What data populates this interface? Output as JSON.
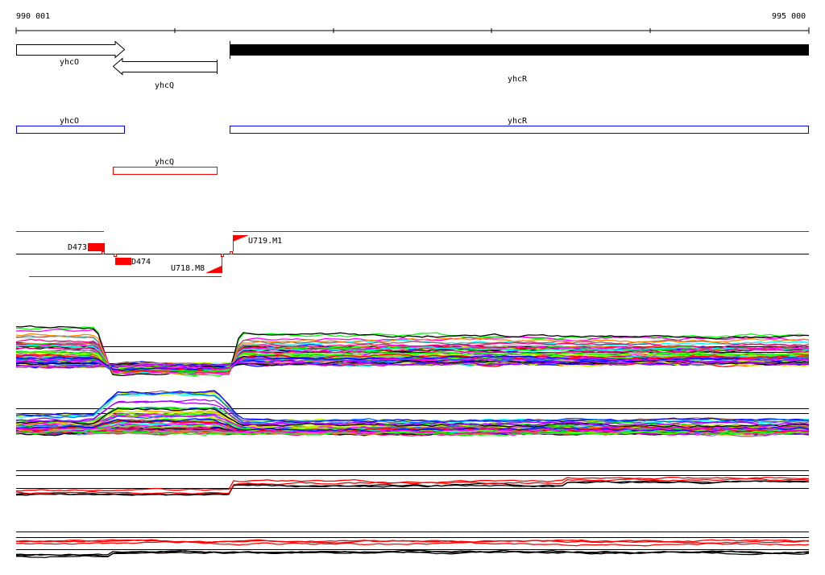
{
  "ruler": {
    "start_label": "990 001",
    "end_label": "995 000"
  },
  "genes": [
    {
      "name": "yhcO",
      "strand": "+"
    },
    {
      "name": "yhcQ",
      "strand": "-"
    },
    {
      "name": "yhcR",
      "strand": "+"
    }
  ],
  "annotation_boxes": [
    {
      "label": "yhcO",
      "color": "#0000ff"
    },
    {
      "label": "yhcR",
      "color": "#0000ff"
    },
    {
      "label": "yhcQ",
      "color": "#ff0000"
    }
  ],
  "features": [
    {
      "label": "D473"
    },
    {
      "label": "D474"
    },
    {
      "label": "U718.M8"
    },
    {
      "label": "U719.M1"
    }
  ],
  "colors": {
    "accent": "#ff0000",
    "series": [
      "#ff0000",
      "#00ff00",
      "#0000ff",
      "#ff00ff",
      "#00ffff",
      "#ff8800",
      "#ccff00",
      "#996666",
      "#999999",
      "#000000",
      "#ff0088",
      "#0066ff",
      "#66ff00",
      "#aa00ff"
    ]
  }
}
